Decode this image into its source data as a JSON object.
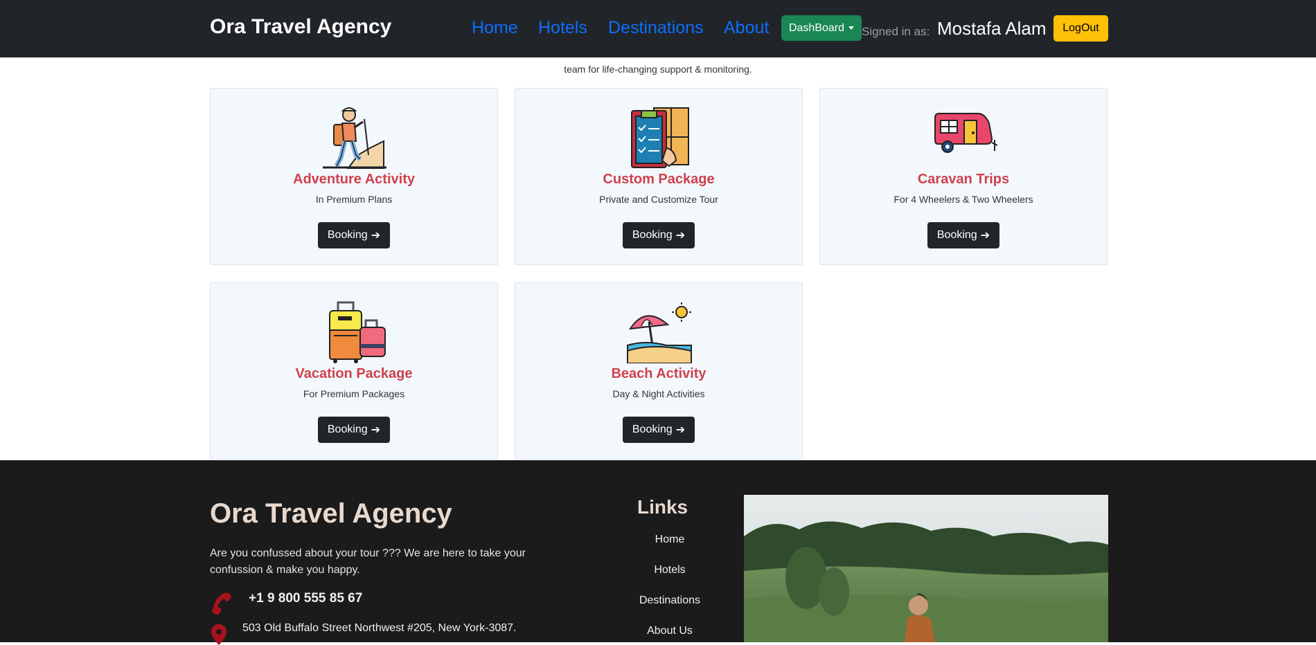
{
  "navbar": {
    "brand": "Ora Travel Agency",
    "links": [
      "Home",
      "Hotels",
      "Destinations",
      "About"
    ],
    "dashboard_label": "DashBoard",
    "signed_in_label": "Signed in as:",
    "user_name": "Mostafa Alam",
    "logout_label": "LogOut"
  },
  "intro": {
    "text": "team for life-changing support & monitoring."
  },
  "cards": [
    {
      "title": "Adventure Activity",
      "subtitle": "In Premium Plans",
      "button": "Booking",
      "icon": "hiker-icon"
    },
    {
      "title": "Custom Package",
      "subtitle": "Private and Customize Tour",
      "button": "Booking",
      "icon": "clipboard-boxes-icon"
    },
    {
      "title": "Caravan Trips",
      "subtitle": "For 4 Wheelers & Two Wheelers",
      "button": "Booking",
      "icon": "caravan-icon"
    },
    {
      "title": "Vacation Package",
      "subtitle": "For Premium Packages",
      "button": "Booking",
      "icon": "luggage-icon"
    },
    {
      "title": "Beach Activity",
      "subtitle": "Day & Night Activities",
      "button": "Booking",
      "icon": "beach-umbrella-icon"
    }
  ],
  "footer": {
    "brand": "Ora Travel Agency",
    "about": "Are you confussed about your tour ??? We are here to take your confussion & make you happy.",
    "phone": "+1 9 800 555 85 67",
    "address": "503 Old Buffalo Street Northwest #205, New York-3087.",
    "links_title": "Links",
    "links": [
      "Home",
      "Hotels",
      "Destinations",
      "About Us"
    ]
  },
  "colors": {
    "navbar_bg": "#212529",
    "nav_link": "#0d6efd",
    "dashboard_btn": "#198754",
    "logout_btn": "#ffc107",
    "card_title": "#d0404c",
    "footer_bg": "#1b1b1b"
  }
}
